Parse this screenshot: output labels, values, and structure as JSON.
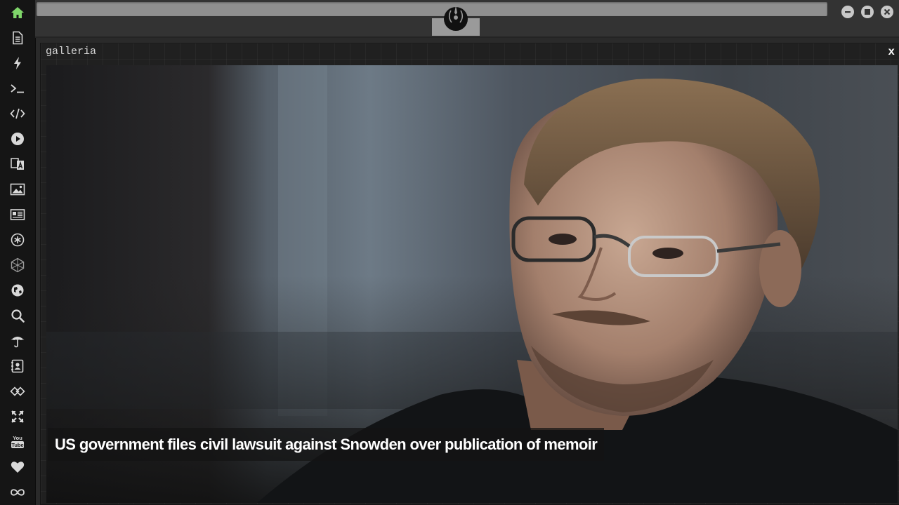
{
  "sidebar": {
    "items": [
      {
        "icon": "home-icon",
        "color": "#7fd66a",
        "active": true
      },
      {
        "icon": "document-icon"
      },
      {
        "icon": "lightning-icon"
      },
      {
        "icon": "terminal-icon"
      },
      {
        "icon": "code-icon"
      },
      {
        "icon": "play-icon"
      },
      {
        "icon": "translate-icon"
      },
      {
        "icon": "image-icon"
      },
      {
        "icon": "newspaper-icon"
      },
      {
        "icon": "asterisk-icon"
      },
      {
        "icon": "network-icon"
      },
      {
        "icon": "globe-icon"
      },
      {
        "icon": "search-icon"
      },
      {
        "icon": "umbrella-icon"
      },
      {
        "icon": "contacts-icon"
      },
      {
        "icon": "tags-icon"
      },
      {
        "icon": "expand-icon"
      },
      {
        "icon": "youtube-icon"
      },
      {
        "icon": "heart-icon"
      },
      {
        "icon": "infinity-icon"
      }
    ]
  },
  "topbar": {
    "emblem_icon": "rebel-alliance-icon",
    "controls": [
      "minimize-icon",
      "maximize-icon",
      "close-icon"
    ]
  },
  "panel": {
    "title": "galleria",
    "close_label": "x"
  },
  "gallery": {
    "caption": "US government files civil lawsuit against Snowden over publication of memoir"
  },
  "colors": {
    "accent": "#7fd66a",
    "rail": "#151515",
    "panel": "#202020"
  }
}
